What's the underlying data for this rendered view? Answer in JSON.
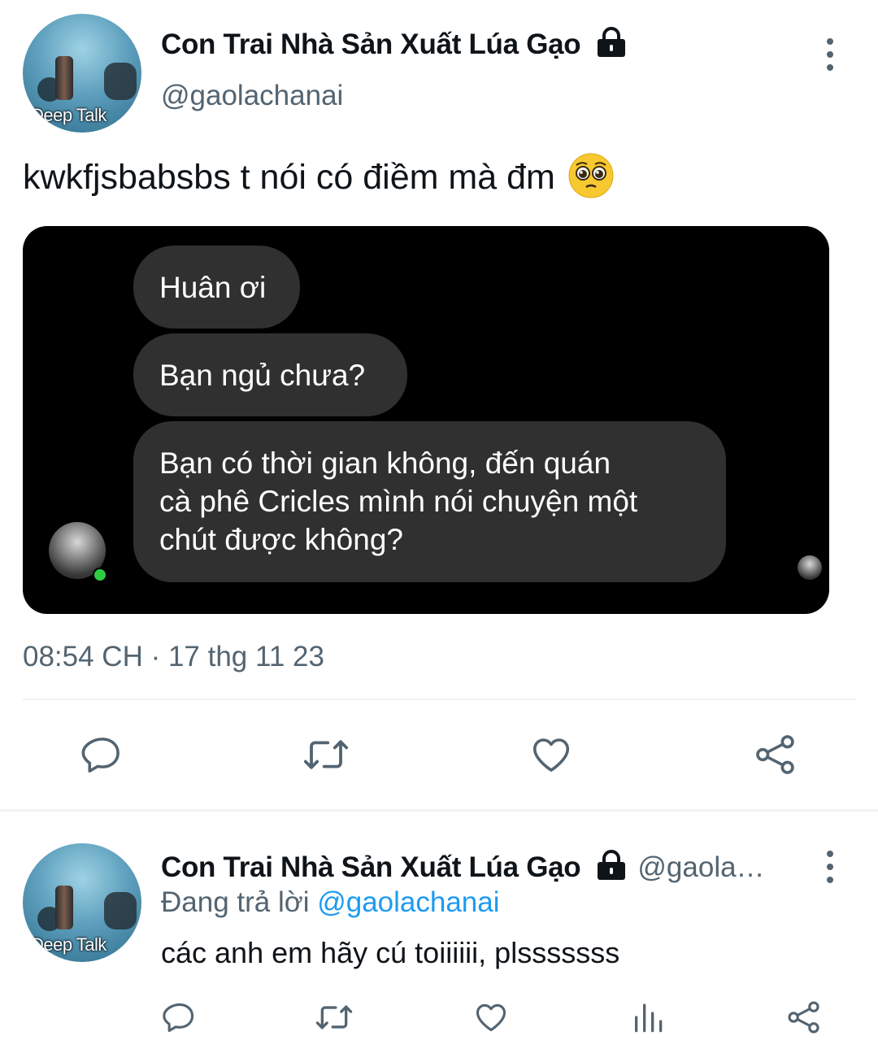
{
  "main_tweet": {
    "author": {
      "display_name": "Con Trai Nhà Sản Xuất Lúa Gạo",
      "handle": "@gaolachanai",
      "avatar_caption": "Deep Talk",
      "protected": true
    },
    "text": "kwkfjsbabsbs t nói có điềm mà đm",
    "emoji": "pleading-face-emoji",
    "media": {
      "messages": [
        {
          "text": "Huân ơi"
        },
        {
          "text": "Bạn ngủ chưa?"
        },
        {
          "lines": [
            "Bạn có thời gian không, đến quán",
            "cà phê Cricles mình nói chuyện một",
            "chút được không?"
          ]
        }
      ]
    },
    "timestamp": "08:54 CH · 17 thg 11 23",
    "actions": [
      "reply-icon",
      "retweet-icon",
      "like-icon",
      "share-icon"
    ]
  },
  "reply_tweet": {
    "author": {
      "display_name": "Con Trai Nhà Sản Xuất Lúa Gạo",
      "handle": "@gaola…",
      "avatar_caption": "Deep Talk",
      "protected": true
    },
    "replying_label": "Đang trả lời",
    "replying_to": "@gaolachanai",
    "text": "các anh em hãy cú toiiiiii, plsssssss",
    "actions": [
      "reply-icon",
      "retweet-icon",
      "like-icon",
      "analytics-icon",
      "share-icon"
    ]
  },
  "colors": {
    "text": "#0f1419",
    "secondary": "#536471",
    "link": "#1d9bf0",
    "bubble": "#303030",
    "online": "#2ecc40"
  }
}
